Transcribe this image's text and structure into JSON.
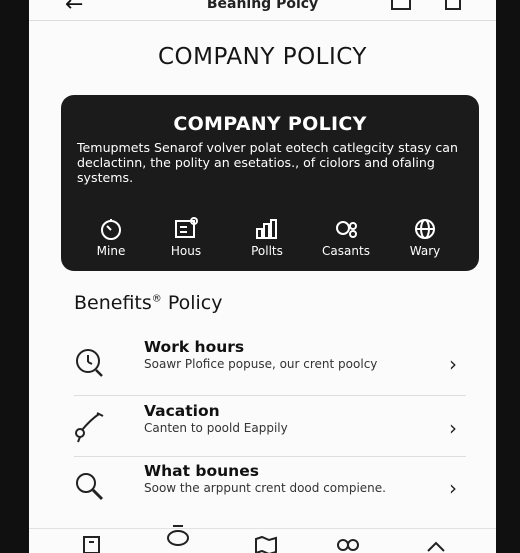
{
  "topbar": {
    "title": "Beaning Poicy"
  },
  "page_title": "COMPANY POLICY",
  "card": {
    "title": "COMPANY POLICY",
    "description": "Temupmets Senarof volver polat eotech catlegcity stasy can declactinn, the polity an esetatios., of ciolors and ofaling systems.",
    "features": [
      {
        "label": "Mine",
        "icon": "timer-icon"
      },
      {
        "label": "Hous",
        "icon": "document-icon"
      },
      {
        "label": "Pollts",
        "icon": "chart-icon"
      },
      {
        "label": "Casants",
        "icon": "people-icon"
      },
      {
        "label": "Wary",
        "icon": "globe-icon"
      }
    ]
  },
  "section": {
    "title": "Benefits",
    "title_mark": "®",
    "title_suffix": " Policy"
  },
  "items": [
    {
      "title": "Work hours",
      "description": "Soawr Plofice popuse, our crent poolcy",
      "icon": "clock-search-icon"
    },
    {
      "title": "Vacation",
      "description": "Canten to poold Eappily",
      "icon": "flamingo-icon"
    },
    {
      "title": "What bounes",
      "description": "Soow the arppunt crent dood compiene.",
      "icon": "magnifier-icon"
    }
  ],
  "bottom_nav": [
    "building-icon",
    "chat-icon",
    "map-icon",
    "group-icon",
    "up-icon"
  ]
}
